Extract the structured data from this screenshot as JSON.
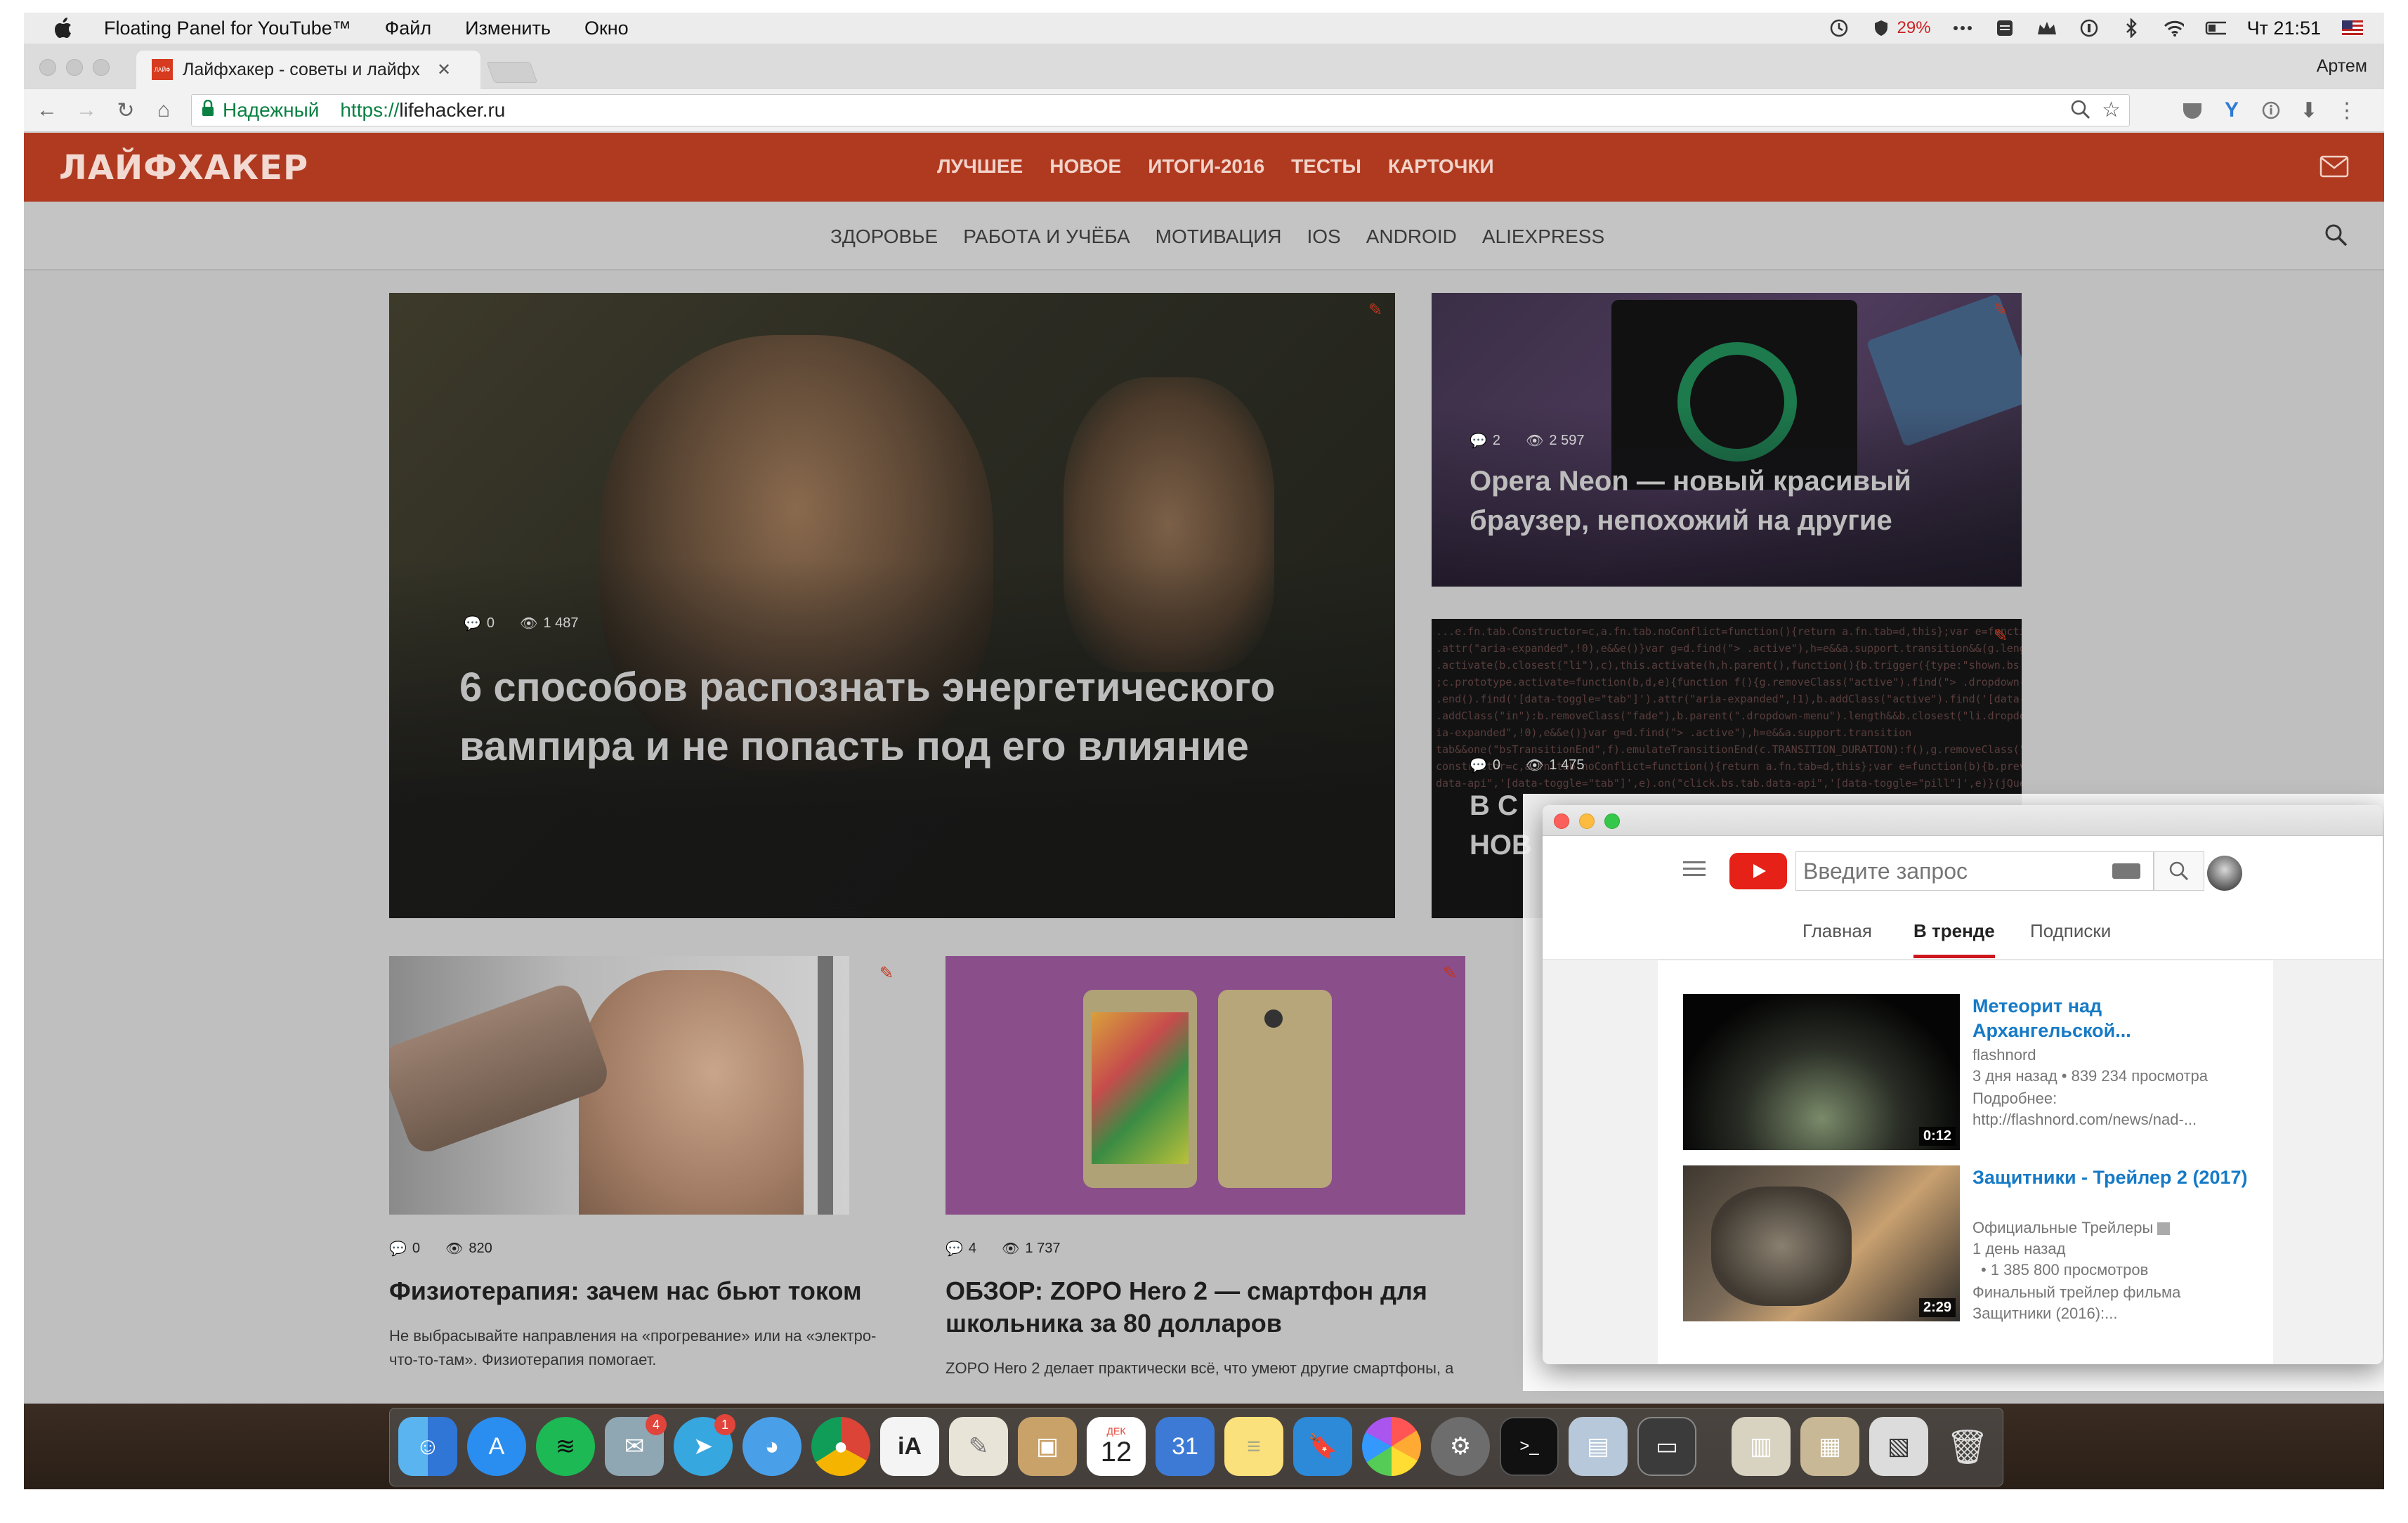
{
  "menubar": {
    "app_name": "Floating Panel for YouTube™",
    "menus": [
      "Файл",
      "Изменить",
      "Окно"
    ],
    "battery_percent": "29%",
    "clock": "Чт 21:51"
  },
  "browser": {
    "tab_title": "Лайфхакер - советы и лайфх",
    "profile": "Артем",
    "secure_label": "Надежный",
    "url_scheme": "https://",
    "url_host": "lifehacker.ru"
  },
  "site": {
    "logo": "ЛАЙФХАКЕР",
    "nav": [
      "ЛУЧШЕЕ",
      "НОВОЕ",
      "ИТОГИ-2016",
      "ТЕСТЫ",
      "КАРТОЧКИ"
    ],
    "subnav": [
      "ЗДОРОВЬЕ",
      "РАБОТА И УЧЁБА",
      "МОТИВАЦИЯ",
      "IOS",
      "ANDROID",
      "ALIEXPRESS"
    ],
    "hero": {
      "comments": "0",
      "views": "1 487",
      "title": "6 способов распознать энергетического вампира и не попасть под его влияние"
    },
    "opera": {
      "comments": "2",
      "views": "2 597",
      "title": "Opera Neon — новый красивый браузер, непохожий на другие"
    },
    "code": {
      "comments": "0",
      "views": "1 475",
      "title_line1": "В С",
      "title_line2": "НОВ"
    },
    "physio": {
      "comments": "0",
      "views": "820",
      "title": "Физиотерапия: зачем нас бьют током",
      "desc": "Не выбрасывайте направления на «прогревание» или на «электро-что-то-там». Физиотерапия помогает."
    },
    "zopo": {
      "comments": "4",
      "views": "1 737",
      "title": "ОБЗОР: ZOPO Hero 2 — смартфон для школьника за 80 долларов",
      "desc": "ZOPO Hero 2 делает практически всё, что умеют другие смартфоны, а стоит совсем недорого"
    }
  },
  "youtube": {
    "search_placeholder": "Введите запрос",
    "tabs": [
      "Главная",
      "В тренде",
      "Подписки"
    ],
    "active_tab": "В тренде",
    "videos": [
      {
        "title": "Метеорит над Архангельской...",
        "channel": "flashnord",
        "age_views": "3 дня назад • 839 234 просмотра",
        "desc1": "Подробнее:",
        "desc2": "http://flashnord.com/news/nad-...",
        "duration": "0:12"
      },
      {
        "title": "Защитники - Трейлер 2 (2017)",
        "channel": "Официальные Трейлеры",
        "age": "1 день назад",
        "views": "• 1 385 800 просмотров",
        "desc1": "Финальный трейлер фильма",
        "desc2": "Защитники (2016):...",
        "duration": "2:29"
      }
    ]
  },
  "dock": {
    "calendar_day": "12",
    "calendar_month": "ДЕК",
    "fantastical_day": "31",
    "badges": [
      "4",
      "1"
    ]
  }
}
